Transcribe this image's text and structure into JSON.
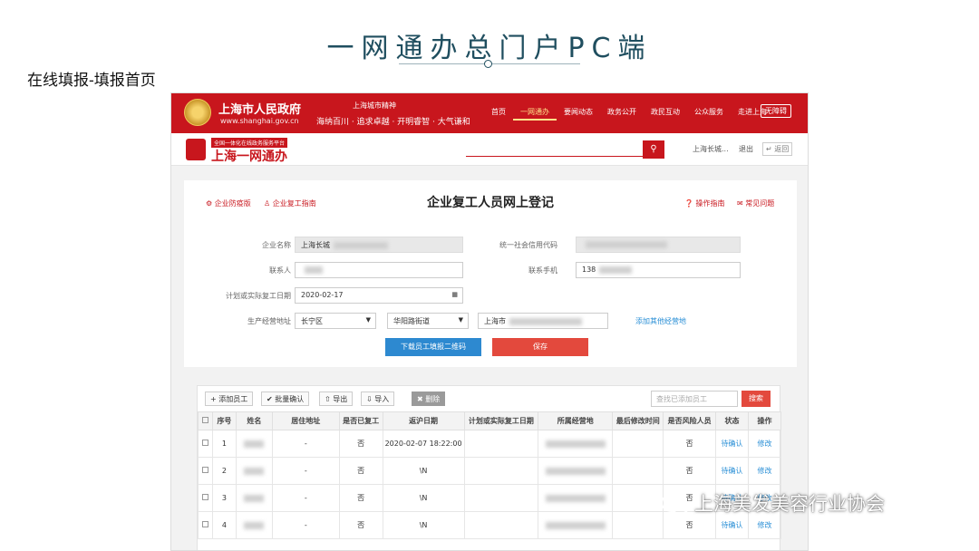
{
  "slide": {
    "title": "一网通办总门户PC端",
    "subtitle": "在线填报-填报首页"
  },
  "gov_header": {
    "name": "上海市人民政府",
    "url": "www.shanghai.gov.cn",
    "slogan_top": "上海城市精神",
    "slogan": "海纳百川 · 追求卓越 · 开明睿智 · 大气谦和",
    "nav": [
      "首页",
      "一网通办",
      "要闻动态",
      "政务公开",
      "政民互动",
      "公众服务",
      "走进上海"
    ],
    "nav_active": "一网通办",
    "accessibility": "无障碍"
  },
  "portal_bar": {
    "tag": "全国一体化在线政务服务平台",
    "name": "上海一网通办",
    "user": "上海长城...",
    "logout": "退出",
    "back": "返回"
  },
  "form": {
    "title": "企业复工人员网上登记",
    "left_links": [
      "企业防疫版",
      "企业复工指南"
    ],
    "right_links": [
      "操作指南",
      "常见问题"
    ],
    "labels": {
      "company": "企业名称",
      "credit_code": "统一社会信用代码",
      "contact": "联系人",
      "phone": "联系手机",
      "date": "计划或实际复工日期",
      "address": "生产经营地址"
    },
    "values": {
      "company": "上海长城",
      "contact": "",
      "phone": "138",
      "date": "2020-02-17",
      "district": "长宁区",
      "street": "华阳路街道",
      "address_prefix": "上海市"
    },
    "add_address": "添加其他经营地",
    "btn_download": "下载员工填报二维码",
    "btn_save": "保存"
  },
  "table": {
    "toolbar": [
      "添加员工",
      "批量确认",
      "导出",
      "导入",
      "删除"
    ],
    "search_placeholder": "查找已添加员工",
    "search_btn": "搜索",
    "headers": [
      "序号",
      "姓名",
      "居住地址",
      "是否已复工",
      "返沪日期",
      "计划或实际复工日期",
      "所属经营地",
      "最后修改时间",
      "是否风险人员",
      "状态",
      "操作"
    ],
    "rows": [
      {
        "no": "1",
        "addr": "-",
        "returned": "否",
        "date": "2020-02-07 18:22:00",
        "risk": "否",
        "status": "待确认",
        "op": "修改"
      },
      {
        "no": "2",
        "addr": "-",
        "returned": "否",
        "date": "\\N",
        "risk": "否",
        "status": "待确认",
        "op": "修改"
      },
      {
        "no": "3",
        "addr": "-",
        "returned": "否",
        "date": "\\N",
        "risk": "否",
        "status": "待确认",
        "op": "修改"
      },
      {
        "no": "4",
        "addr": "-",
        "returned": "否",
        "date": "\\N",
        "risk": "否",
        "status": "待确认",
        "op": "修改"
      }
    ]
  },
  "watermark": "上海美发美容行业协会",
  "colors": {
    "brand_red": "#c8161d",
    "title_teal": "#1f4e5f",
    "button_blue": "#2d89d0",
    "button_red": "#e3493d"
  }
}
